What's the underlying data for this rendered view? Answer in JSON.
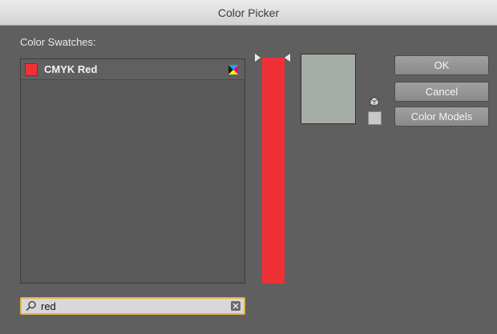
{
  "window": {
    "title": "Color Picker"
  },
  "swatches": {
    "label": "Color Swatches:",
    "items": [
      {
        "name": "CMYK Red",
        "color": "#ef3137",
        "icon": "cmyk-icon"
      }
    ]
  },
  "search": {
    "value": "red",
    "icon": "search-icon",
    "clear_icon": "clear-icon"
  },
  "selected_color": {
    "preview": "#a5ada6",
    "hue_slider": "#ef3137"
  },
  "buttons": {
    "ok": "OK",
    "cancel": "Cancel",
    "color_models": "Color Models"
  }
}
